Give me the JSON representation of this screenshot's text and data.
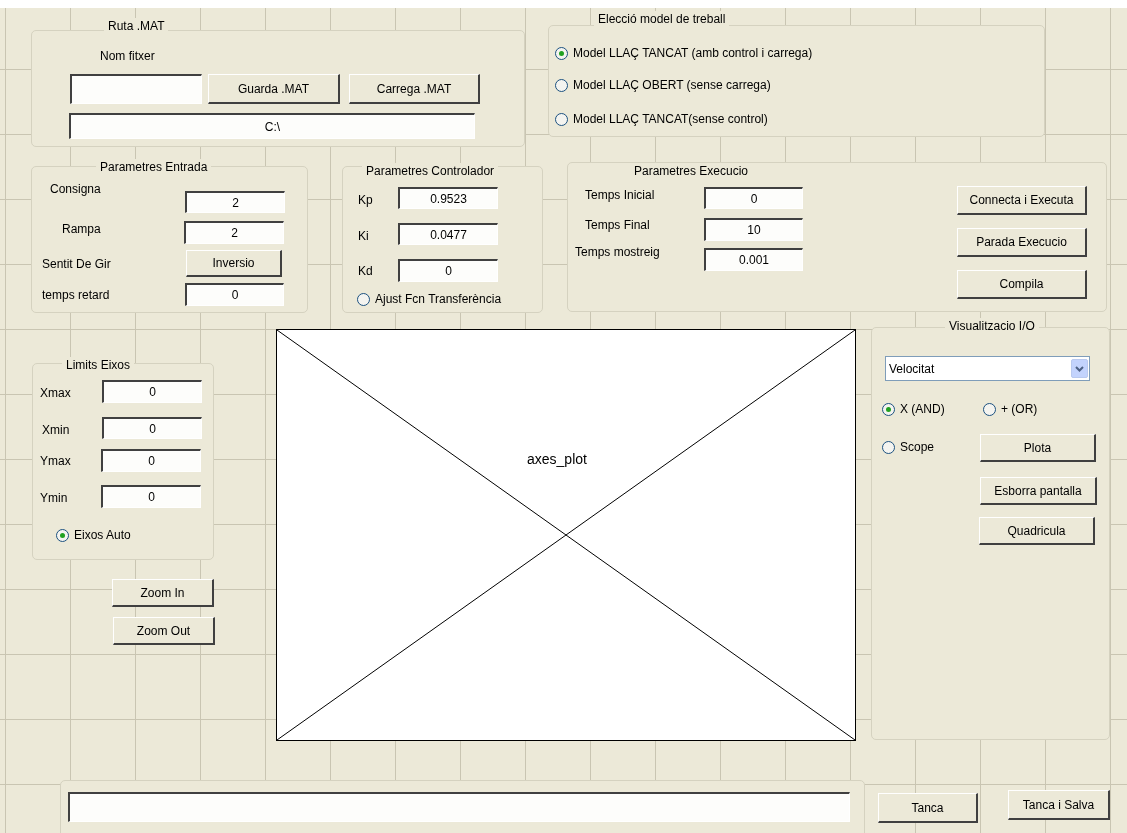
{
  "ruta_mat": {
    "title": "Ruta .MAT",
    "label": "Nom fitxer",
    "buttons": [
      "Guarda .MAT",
      "Carrega .MAT"
    ],
    "path": "C:\\"
  },
  "model": {
    "title": "Elecció model de treball",
    "options": [
      {
        "label": "Model LLAÇ TANCAT (amb control i carrega)",
        "selected": true
      },
      {
        "label": "Model LLAÇ OBERT (sense carrega)",
        "selected": false
      },
      {
        "label": "Model LLAÇ TANCAT(sense control)",
        "selected": false
      }
    ]
  },
  "entrada": {
    "title": "Parametres Entrada",
    "rows": [
      {
        "label": "Consigna",
        "kind": "field",
        "value": "2"
      },
      {
        "label": "Rampa",
        "kind": "field",
        "value": "2"
      },
      {
        "label": "Sentit De Gir",
        "kind": "button",
        "value": "Inversio"
      },
      {
        "label": "temps retard",
        "kind": "field",
        "value": "0"
      }
    ]
  },
  "controlador": {
    "title": "Parametres Controlador",
    "gains": [
      {
        "label": "Kp",
        "value": "0.9523"
      },
      {
        "label": "Ki",
        "value": "0.0477"
      },
      {
        "label": "Kd",
        "value": "0"
      }
    ],
    "option": {
      "label": "Ajust Fcn Transferència",
      "selected": false
    }
  },
  "execucio": {
    "title": "Parametres Execucio",
    "fields": [
      {
        "label": "Temps Inicial",
        "value": "0"
      },
      {
        "label": "Temps Final",
        "value": "10"
      },
      {
        "label": "Temps mostreig",
        "value": "0.001"
      }
    ],
    "buttons": [
      "Connecta i Executa",
      "Parada Execucio",
      "Compila"
    ]
  },
  "limits": {
    "title": "Limits Eixos",
    "fields": [
      {
        "label": "Xmax",
        "value": "0"
      },
      {
        "label": "Xmin",
        "value": "0"
      },
      {
        "label": "Ymax",
        "value": "0"
      },
      {
        "label": "Ymin",
        "value": "0"
      }
    ],
    "option": {
      "label": "Eixos Auto",
      "selected": true
    }
  },
  "zoom_buttons": [
    "Zoom In",
    "Zoom Out"
  ],
  "axes": {
    "label": "axes_plot"
  },
  "visualitzacio": {
    "title": "Visualitzacio I/O",
    "dropdown": "Velocitat",
    "options": [
      {
        "label": "X (AND)",
        "selected": true
      },
      {
        "label": "+ (OR)",
        "selected": false
      },
      {
        "label": "Scope",
        "selected": false
      }
    ],
    "buttons": [
      "Plota",
      "Esborra pantalla",
      "Quadricula"
    ]
  },
  "footer": {
    "buttons": [
      "Tanca",
      "Tanca i Salva"
    ]
  }
}
